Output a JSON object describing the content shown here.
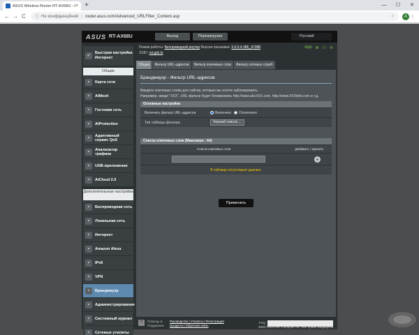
{
  "browser": {
    "tab_title": "ASUS Wireless Router RT-AX68U - U",
    "tab_close": "×",
    "new_tab": "+",
    "win_min": "—",
    "win_max": "☐",
    "win_close": "✕",
    "back": "←",
    "forward": "→",
    "reload": "C",
    "not_secure": "Не конфіденційний",
    "url": "router.asus.com/Advanced_URLFilter_Content.asp",
    "avatar_letter": "A"
  },
  "router": {
    "logo": "ASUS",
    "model": "RT-AX68U",
    "logout": "Выход",
    "reboot": "Перезагрузка",
    "language": "Русский",
    "mode_label": "Режим работы:",
    "mode_value": "Беспроводной роутер",
    "fw_label": "Версия прошивки:",
    "fw_value": "3.0.0.4.386_47388",
    "ssid_label": "SSID:",
    "ssid_value": "rst.gdz.ls",
    "app_label": "App",
    "colors": {
      "accent": "#5e8ab0",
      "warn": "#ffcc00",
      "status_green": "#7ec242"
    }
  },
  "sidebar": {
    "quick_setup": "Быстрая настройка Интернет",
    "general_header": "Общие",
    "general": [
      {
        "label": "Карта сети",
        "icon": "network-map-icon"
      },
      {
        "label": "AiMesh",
        "icon": "aimesh-icon"
      },
      {
        "label": "Гостевая сеть",
        "icon": "guest-network-icon"
      },
      {
        "label": "AiProtection",
        "icon": "shield-icon"
      },
      {
        "label": "Адаптивный сервис QoS",
        "icon": "qos-icon"
      },
      {
        "label": "Анализатор трафика",
        "icon": "traffic-analyzer-icon"
      },
      {
        "label": "USB-приложение",
        "icon": "usb-icon"
      },
      {
        "label": "AiCloud 2.0",
        "icon": "cloud-icon"
      }
    ],
    "advanced_header": "Дополнительные настройки",
    "advanced": [
      {
        "label": "Беспроводная сеть",
        "icon": "wireless-icon"
      },
      {
        "label": "Локальная сеть",
        "icon": "lan-icon"
      },
      {
        "label": "Интернет",
        "icon": "globe-icon"
      },
      {
        "label": "Amazon Alexa",
        "icon": "alexa-icon"
      },
      {
        "label": "IPv6",
        "icon": "ipv6-icon"
      },
      {
        "label": "VPN",
        "icon": "vpn-icon"
      },
      {
        "label": "Брандмауэр",
        "icon": "firewall-icon",
        "active": true
      },
      {
        "label": "Администрирование",
        "icon": "admin-icon"
      },
      {
        "label": "Системный журнал",
        "icon": "log-icon"
      },
      {
        "label": "Сетевые утилиты",
        "icon": "tools-icon"
      }
    ]
  },
  "content": {
    "tabs": [
      "Общие",
      "Фильтр URL-адресов",
      "Фильтр ключевых слов",
      "Фильтр сетевых служб"
    ],
    "title": "Брандмауэр - Фильтр URL-адресов",
    "desc1": "Введите ключевые слова для сайтов, которые вы хотите заблокировать.",
    "desc2": "Например, введя \"XXX\", URL-фильтр будет блокировать http://www.abcXXX.com, http://www.XXXbbb.com и т.д.",
    "basic_header": "Основные настройки",
    "enable_label": "Включить фильтр URL-адресов",
    "enable_on": "Включено",
    "enable_off": "Отключено",
    "table_type_label": "Тип таблицы фильтра",
    "table_type_value": "Черный список",
    "list_header": "Список ключевых слов (Максимум : 64)",
    "col_keywords": "Список ключевых слов",
    "col_addremove": "Добавить / Удалить",
    "empty_text": "В таблице отсутствуют данные.",
    "apply": "Применить"
  },
  "footer": {
    "help": "Помощь & Поддержка",
    "links1": "Руководство | Утилиты | Регистрация",
    "links2": "продукта | Обратная связь",
    "faq": "FAQ",
    "copyright": "2020 ASUSTeK Computer Inc. Все права защищены."
  }
}
